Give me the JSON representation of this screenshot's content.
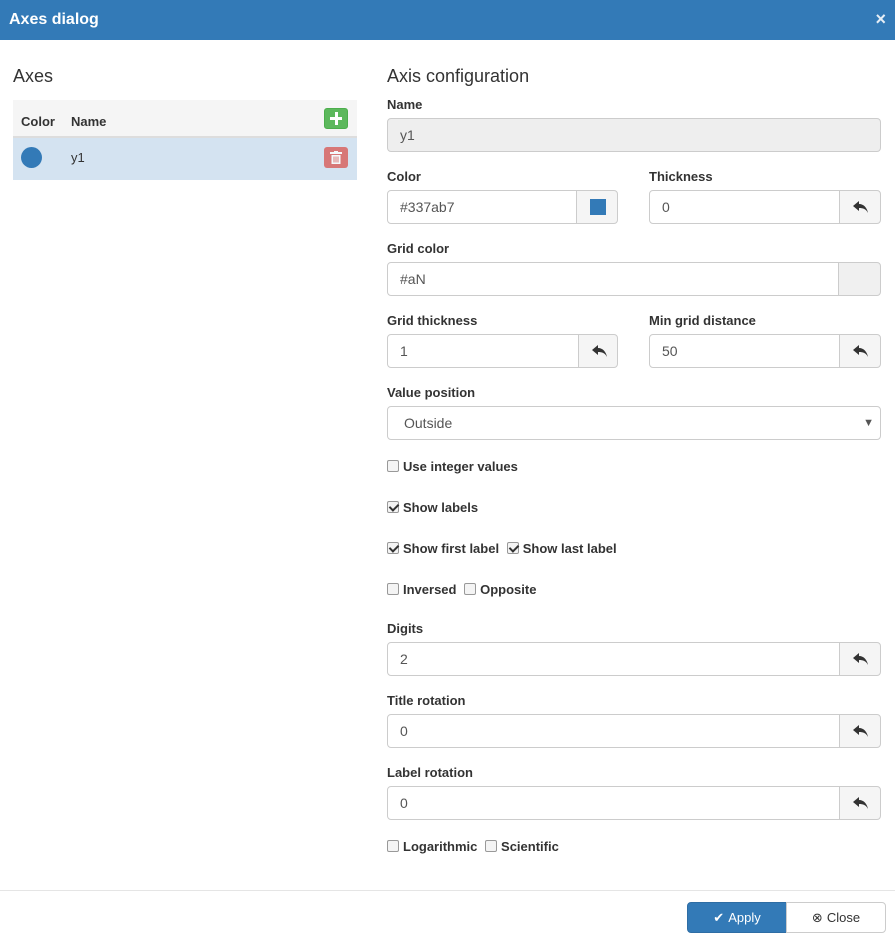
{
  "dialog": {
    "title": "Axes dialog",
    "close_glyph": "×",
    "header_color": "#337ab7"
  },
  "axes_panel": {
    "title": "Axes",
    "columns": {
      "color": "Color",
      "name": "Name"
    },
    "rows": [
      {
        "name": "y1",
        "color": "#337ab7"
      }
    ],
    "add_icon": "plus-icon",
    "delete_icon": "trash-icon"
  },
  "config": {
    "title": "Axis configuration",
    "name": {
      "label": "Name",
      "value": "y1"
    },
    "color": {
      "label": "Color",
      "value": "#337ab7"
    },
    "thickness": {
      "label": "Thickness",
      "value": "0"
    },
    "grid_color": {
      "label": "Grid color",
      "value": "#aN"
    },
    "grid_thickness": {
      "label": "Grid thickness",
      "value": "1"
    },
    "min_grid_distance": {
      "label": "Min grid distance",
      "value": "50"
    },
    "value_position": {
      "label": "Value position",
      "value": "Outside"
    },
    "checkboxes": {
      "use_integer": {
        "label": "Use integer values",
        "checked": false
      },
      "show_labels": {
        "label": "Show labels",
        "checked": true
      },
      "show_first": {
        "label": "Show first label",
        "checked": true
      },
      "show_last": {
        "label": "Show last label",
        "checked": true
      },
      "inversed": {
        "label": "Inversed",
        "checked": false
      },
      "opposite": {
        "label": "Opposite",
        "checked": false
      },
      "logarithmic": {
        "label": "Logarithmic",
        "checked": false
      },
      "scientific": {
        "label": "Scientific",
        "checked": false
      }
    },
    "digits": {
      "label": "Digits",
      "value": "2"
    },
    "title_rotation": {
      "label": "Title rotation",
      "value": "0"
    },
    "label_rotation": {
      "label": "Label rotation",
      "value": "0"
    },
    "reset_icon": "undo-icon"
  },
  "footer": {
    "apply_label": "Apply",
    "close_label": "Close",
    "apply_icon": "check-icon",
    "close_icon": "circle-x-icon"
  }
}
